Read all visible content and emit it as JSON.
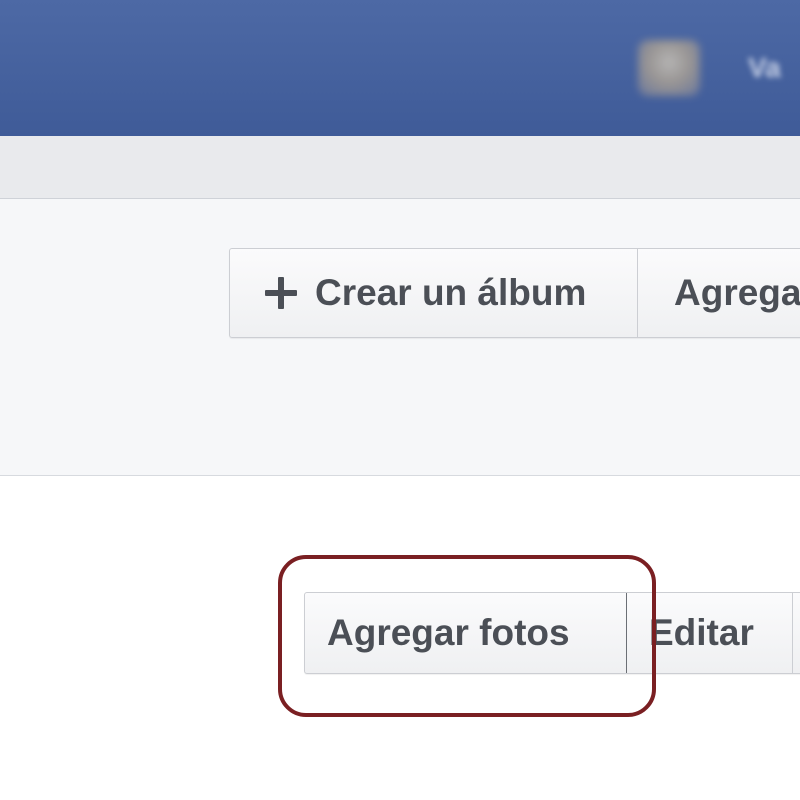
{
  "header": {
    "username": "Va"
  },
  "album_toolbar": {
    "create_album_label": "Crear un álbum",
    "add_label": "Agrega"
  },
  "photo_actions": {
    "add_photos_label": "Agregar fotos",
    "edit_label": "Editar"
  },
  "colors": {
    "topbar": "#3f5b98",
    "highlight_outline": "#7a1f22"
  }
}
